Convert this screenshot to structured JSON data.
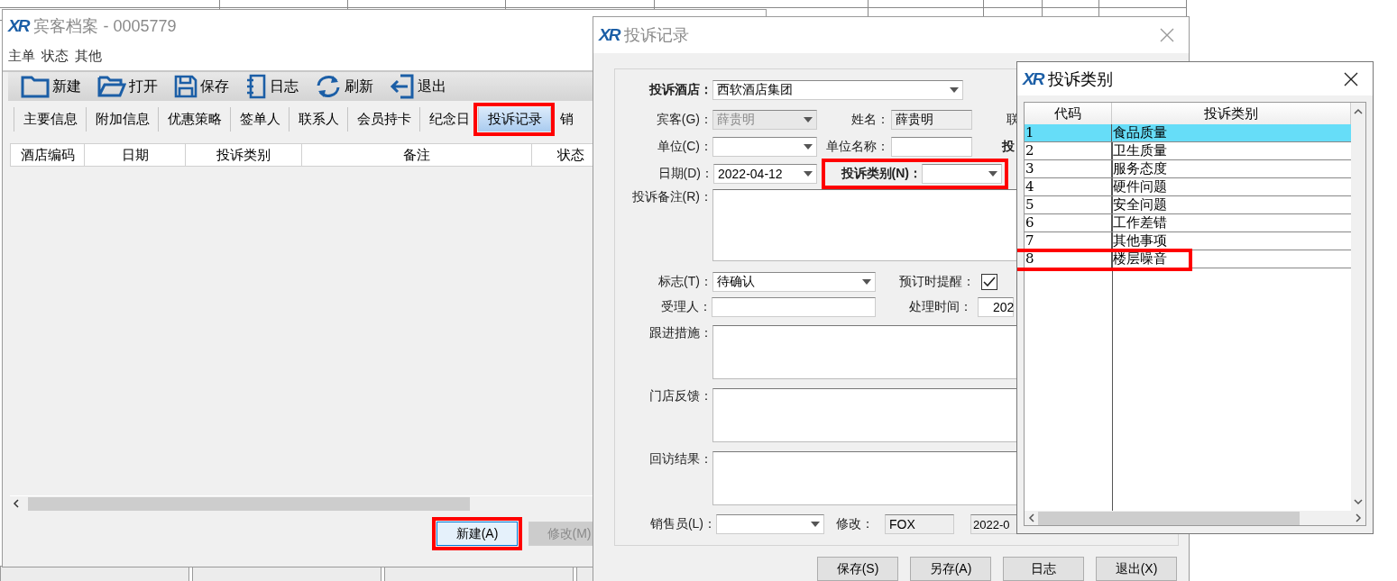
{
  "main_window": {
    "logo": "XR",
    "title": "宾客档案 - 0005779",
    "menu": [
      "主单",
      "状态",
      "其他"
    ],
    "toolbar": [
      {
        "kind": "new",
        "label": "新建"
      },
      {
        "kind": "open",
        "label": "打开"
      },
      {
        "kind": "save",
        "label": "保存"
      },
      {
        "kind": "log",
        "label": "日志"
      },
      {
        "kind": "refresh",
        "label": "刷新"
      },
      {
        "kind": "exit",
        "label": "退出"
      }
    ],
    "tabs": [
      {
        "label": "主要信息",
        "selected": false,
        "highlighted": false
      },
      {
        "label": "附加信息",
        "selected": false,
        "highlighted": false
      },
      {
        "label": "优惠策略",
        "selected": false,
        "highlighted": false
      },
      {
        "label": "签单人",
        "selected": false,
        "highlighted": false
      },
      {
        "label": "联系人",
        "selected": false,
        "highlighted": false
      },
      {
        "label": "会员持卡",
        "selected": false,
        "highlighted": false
      },
      {
        "label": "纪念日",
        "selected": false,
        "highlighted": false
      },
      {
        "label": "投诉记录",
        "selected": true,
        "highlighted": true
      },
      {
        "label": "销",
        "selected": false,
        "highlighted": false
      }
    ],
    "table": {
      "columns": [
        "酒店编码",
        "日期",
        "投诉类别",
        "备注",
        "状态"
      ]
    },
    "buttons": [
      {
        "label": "新建(A)",
        "disabled": false,
        "highlighted": true
      },
      {
        "label": "修改(M)",
        "disabled": true,
        "highlighted": false
      }
    ]
  },
  "complaint_dialog": {
    "logo": "XR",
    "title": "投诉记录",
    "hotel": {
      "label": "投诉酒店：",
      "value": "西软酒店集团"
    },
    "guest": {
      "label": "宾客(G)：",
      "value": "薛贵明",
      "disabled": true
    },
    "name": {
      "label": "姓名：",
      "value": "薛贵明"
    },
    "contact_label": "联",
    "company": {
      "label": "单位(C)："
    },
    "company_name": {
      "label": "单位名称："
    },
    "complaint_label_cut": "投",
    "date": {
      "label": "日期(D)：",
      "value": "2022-04-12"
    },
    "complaint_type": {
      "label": "投诉类别(N)：",
      "highlighted": true
    },
    "remark": {
      "label": "投诉备注(R)："
    },
    "flag": {
      "label": "标志(T)：",
      "value": "待确认"
    },
    "reminder": {
      "label": "预订时提醒：",
      "checked": true
    },
    "handler": {
      "label": "受理人："
    },
    "handle_time": {
      "label": "处理时间：",
      "value": "202"
    },
    "follow_up": {
      "label": "跟进措施："
    },
    "store_feedback": {
      "label": "门店反馈："
    },
    "revisit_result": {
      "label": "回访结果："
    },
    "salesperson": {
      "label": "销售员(L)："
    },
    "modified": {
      "label": "修改：",
      "value": "FOX"
    },
    "modified_time": {
      "value": "2022-0"
    },
    "buttons": [
      "保存(S)",
      "另存(A)",
      "日志",
      "退出(X)"
    ]
  },
  "category_window": {
    "logo": "XR",
    "title": "投诉类别",
    "columns": [
      "代码",
      "投诉类别"
    ],
    "rows": [
      {
        "code": "1",
        "name": "食品质量",
        "selected": true,
        "highlighted": false
      },
      {
        "code": "2",
        "name": "卫生质量",
        "selected": false,
        "highlighted": false
      },
      {
        "code": "3",
        "name": "服务态度",
        "selected": false,
        "highlighted": false
      },
      {
        "code": "4",
        "name": "硬件问题",
        "selected": false,
        "highlighted": false
      },
      {
        "code": "5",
        "name": "安全问题",
        "selected": false,
        "highlighted": false
      },
      {
        "code": "6",
        "name": "工作差错",
        "selected": false,
        "highlighted": false
      },
      {
        "code": "7",
        "name": "其他事项",
        "selected": false,
        "highlighted": false
      },
      {
        "code": "8",
        "name": "楼层噪音",
        "selected": false,
        "highlighted": true
      }
    ]
  }
}
